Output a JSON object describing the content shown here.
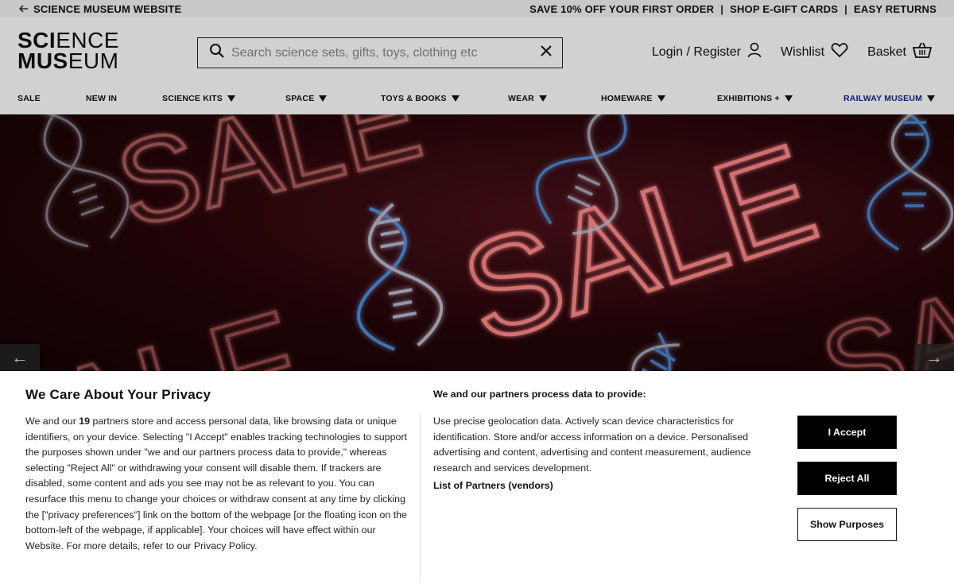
{
  "topbar": {
    "back_label": "SCIENCE MUSEUM WEBSITE",
    "promos": [
      "SAVE 10% OFF YOUR FIRST ORDER",
      "SHOP E-GIFT CARDS",
      "EASY RETURNS"
    ]
  },
  "header": {
    "logo_line1_bold": "SCI",
    "logo_line1_rest": "ENCE",
    "logo_line2_bold": "MUS",
    "logo_line2_rest": "EUM",
    "search_placeholder": "Search science sets, gifts, toys, clothing etc",
    "login_label": "Login / Register",
    "wishlist_label": "Wishlist",
    "basket_label": "Basket"
  },
  "nav": {
    "items": [
      {
        "label": "SALE",
        "dropdown": false
      },
      {
        "label": "NEW IN",
        "dropdown": false
      },
      {
        "label": "SCIENCE KITS",
        "dropdown": true
      },
      {
        "label": "SPACE",
        "dropdown": true
      },
      {
        "label": "TOYS & BOOKS",
        "dropdown": true
      },
      {
        "label": "WEAR",
        "dropdown": true
      },
      {
        "label": "HOMEWARE",
        "dropdown": true
      },
      {
        "label": "EXHIBITIONS +",
        "dropdown": true
      },
      {
        "label": "RAILWAY MUSEUM",
        "dropdown": true
      }
    ]
  },
  "hero": {
    "neon_text": "SALE",
    "neon_text_partial": "ALE",
    "neon_text_partial2": "ALF",
    "neon_text_partial3": "SA"
  },
  "privacy": {
    "title": "We Care About Your Privacy",
    "body_prefix": "We and our ",
    "partner_count": "19",
    "body_rest": " partners store and access personal data, like browsing data or unique identifiers, on your device. Selecting \"I Accept\" enables tracking technologies to support the purposes shown under \"we and our partners process data to provide,\" whereas selecting \"Reject All\" or withdrawing your consent will disable them. If trackers are disabled, some content and ads you see may not be as relevant to you. You can resurface this menu to change your choices or withdraw consent at any time by clicking the [\"privacy preferences\"] link on the bottom of the webpage [or the floating icon on the bottom-left of the webpage, if applicable]. Your choices will have effect within our Website. For more details, refer to our Privacy Policy.",
    "purposes_title": "We and our partners process data to provide:",
    "purposes_text": "Use precise geolocation data. Actively scan device characteristics for identification. Store and/or access information on a device. Personalised advertising and content, advertising and content measurement, audience research and services development.",
    "partners_link": "List of Partners (vendors)",
    "accept_label": "I Accept",
    "reject_label": "Reject All",
    "purposes_button_label": "Show Purposes"
  },
  "colors": {
    "neon_red": "#ff6b6b",
    "neon_blue": "#4aa3ff",
    "railway_link": "#1a237e"
  }
}
